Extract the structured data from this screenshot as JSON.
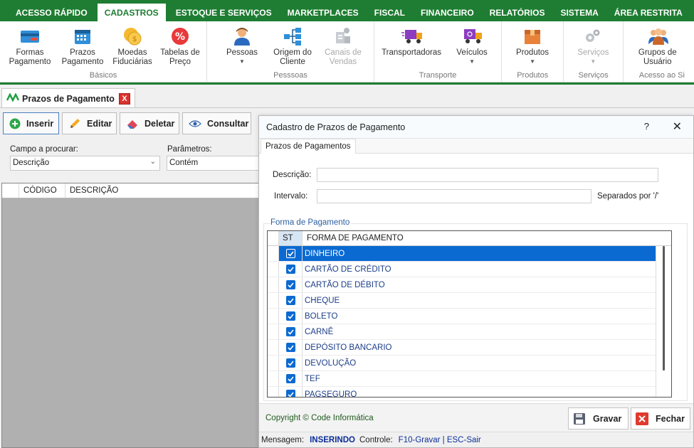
{
  "menu": [
    "ACESSO RÁPIDO",
    "CADASTROS",
    "ESTOQUE E SERVIÇOS",
    "MARKETPLACES",
    "FISCAL",
    "FINANCEIRO",
    "RELATÓRIOS",
    "SISTEMA",
    "ÁREA RESTRITA"
  ],
  "ribbon": {
    "basicos": {
      "label": "Básicos",
      "formas": "Formas\nPagamento",
      "prazos": "Prazos\nPagamento",
      "moedas": "Moedas\nFiduciárias",
      "tabelas": "Tabelas de\nPreço"
    },
    "pessoas": {
      "label": "Pesssoas",
      "pessoas": "Pessoas",
      "origem": "Origem do\nCliente",
      "canais": "Canais de\nVendas"
    },
    "transporte": {
      "label": "Transporte",
      "transportadoras": "Transportadoras",
      "veiculos": "Veículos"
    },
    "produtos": {
      "label": "Produtos",
      "produtos": "Produtos"
    },
    "servicos": {
      "label": "Serviços",
      "servicos": "Serviços"
    },
    "acesso": {
      "label": "Acesso ao Si",
      "grupos": "Grupos de\nUsuário"
    }
  },
  "doc_tab": {
    "title": "Prazos de Pagamento",
    "close": "X"
  },
  "toolbar": {
    "insert": "Inserir",
    "edit": "Editar",
    "delete": "Deletar",
    "query": "Consultar"
  },
  "search": {
    "field_label": "Campo a procurar:",
    "field_value": "Descrição",
    "param_label": "Parâmetros:",
    "param_value": "Contém"
  },
  "grid": {
    "col_code": "CÓDIGO",
    "col_desc": "DESCRIÇÃO"
  },
  "dialog": {
    "title": "Cadastro de Prazos de Pagamento",
    "help": "?",
    "close": "✕",
    "tab": "Prazos de Pagamentos",
    "descricao_label": "Descrição:",
    "descricao_value": "",
    "intervalo_label": "Intervalo:",
    "intervalo_value": "",
    "separados": "Separados por '/'",
    "forma_label": "Forma de Pagamento",
    "col_st": "ST",
    "col_forma": "FORMA DE PAGAMENTO",
    "rows": [
      "DINHEIRO",
      "CARTÃO DE CRÉDITO",
      "CARTÃO DE DÉBITO",
      "CHEQUE",
      "BOLETO",
      "CARNÊ",
      "DEPÓSITO BANCARIO",
      "DEVOLUÇÃO",
      "TEF",
      "PAGSEGURO"
    ],
    "copyright": "Copyright © Code Informática",
    "save": "Gravar",
    "close_btn": "Fechar",
    "status_msg_label": "Mensagem:",
    "status_msg": "INSERINDO",
    "status_ctrl_label": "Controle:",
    "status_ctrl": "F10-Gravar | ESC-Sair"
  }
}
